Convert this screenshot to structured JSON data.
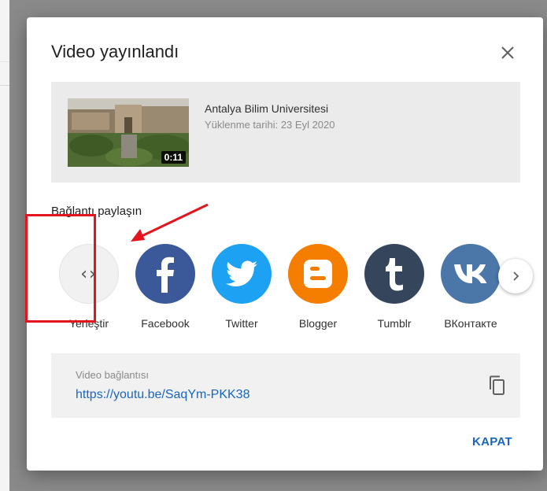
{
  "dialog": {
    "title": "Video yayınlandı",
    "close_label": "KAPAT"
  },
  "video": {
    "title": "Antalya Bilim Universitesi",
    "upload_date": "Yüklenme tarihi: 23 Eyl 2020",
    "duration": "0:11"
  },
  "share": {
    "heading": "Bağlantı paylaşın",
    "items": [
      {
        "label": "Yerleştir",
        "icon": "embed-code-icon",
        "color": "#f1f1f1"
      },
      {
        "label": "Facebook",
        "icon": "facebook-icon",
        "color": "#3b5998"
      },
      {
        "label": "Twitter",
        "icon": "twitter-icon",
        "color": "#1da1f2"
      },
      {
        "label": "Blogger",
        "icon": "blogger-icon",
        "color": "#f57d00"
      },
      {
        "label": "Tumblr",
        "icon": "tumblr-icon",
        "color": "#35465c"
      },
      {
        "label": "ВКонтакте",
        "icon": "vk-icon",
        "color": "#4a76a8"
      }
    ]
  },
  "link": {
    "caption": "Video bağlantısı",
    "url": "https://youtu.be/SaqYm-PKK38"
  },
  "colors": {
    "accent": "#1a65c0",
    "highlight": "#e3141e"
  }
}
